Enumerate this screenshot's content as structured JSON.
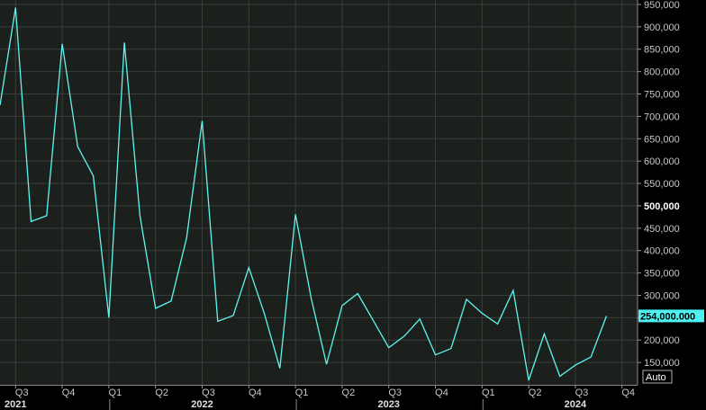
{
  "chart_data": {
    "type": "line",
    "title": "",
    "xlabel": "",
    "ylabel": "",
    "ylim": [
      100000,
      960000
    ],
    "y_ticks": [
      150000,
      200000,
      250000,
      300000,
      350000,
      400000,
      450000,
      500000,
      550000,
      600000,
      650000,
      700000,
      750000,
      800000,
      850000,
      900000,
      950000
    ],
    "y_tick_labels": [
      "150,000",
      "200,000",
      "250,000",
      "300,000",
      "350,000",
      "400,000",
      "450,000",
      "500,000",
      "550,000",
      "600,000",
      "650,000",
      "700,000",
      "750,000",
      "800,000",
      "850,000",
      "900,000",
      "950,000"
    ],
    "highlighted_tick": "500,000",
    "x_start": "2021-06",
    "x_end": "2024-11",
    "quarter_ticks": [
      {
        "date": "2021-07",
        "label": "Q3"
      },
      {
        "date": "2021-10",
        "label": "Q4"
      },
      {
        "date": "2022-01",
        "label": "Q1"
      },
      {
        "date": "2022-04",
        "label": "Q2"
      },
      {
        "date": "2022-07",
        "label": "Q3"
      },
      {
        "date": "2022-10",
        "label": "Q4"
      },
      {
        "date": "2023-01",
        "label": "Q1"
      },
      {
        "date": "2023-04",
        "label": "Q2"
      },
      {
        "date": "2023-07",
        "label": "Q3"
      },
      {
        "date": "2023-10",
        "label": "Q4"
      },
      {
        "date": "2024-01",
        "label": "Q1"
      },
      {
        "date": "2024-04",
        "label": "Q2"
      },
      {
        "date": "2024-07",
        "label": "Q3"
      },
      {
        "date": "2024-10",
        "label": "Q4"
      }
    ],
    "year_labels": [
      {
        "center": "2021-07",
        "label": "2021"
      },
      {
        "center": "2022-07",
        "label": "2022"
      },
      {
        "center": "2023-07",
        "label": "2023"
      },
      {
        "center": "2024-07",
        "label": "2024"
      }
    ],
    "year_dividers": [
      "2022-01",
      "2023-01",
      "2024-01"
    ],
    "series": [
      {
        "color": "#5ff5f0",
        "x": [
          "2021-06",
          "2021-07",
          "2021-08",
          "2021-09",
          "2021-10",
          "2021-11",
          "2021-12",
          "2022-01",
          "2022-02",
          "2022-03",
          "2022-04",
          "2022-05",
          "2022-06",
          "2022-07",
          "2022-08",
          "2022-09",
          "2022-10",
          "2022-11",
          "2022-12",
          "2023-01",
          "2023-02",
          "2023-03",
          "2023-04",
          "2023-05",
          "2023-06",
          "2023-07",
          "2023-08",
          "2023-09",
          "2023-10",
          "2023-11",
          "2023-12",
          "2024-01",
          "2024-02",
          "2024-03",
          "2024-04",
          "2024-05",
          "2024-06",
          "2024-07",
          "2024-08",
          "2024-09"
        ],
        "values": [
          725000,
          943000,
          465000,
          478000,
          862000,
          632000,
          567000,
          250000,
          865000,
          478000,
          271000,
          287000,
          428000,
          690000,
          242000,
          255000,
          362000,
          259000,
          137000,
          481000,
          295000,
          146000,
          277000,
          304000,
          244000,
          183000,
          209000,
          247000,
          167000,
          181000,
          291000,
          260000,
          236000,
          311000,
          110000,
          214000,
          119000,
          144000,
          162000,
          254000
        ]
      }
    ],
    "last_value_label": "254,000.000",
    "scale_button": "Auto",
    "grid": true,
    "colors": {
      "background": "#000000",
      "plot_background": "#1c201c",
      "grid": "#3a3e3a",
      "line": "#5ff5f0",
      "last_value_bg": "#4ef0f0"
    }
  }
}
